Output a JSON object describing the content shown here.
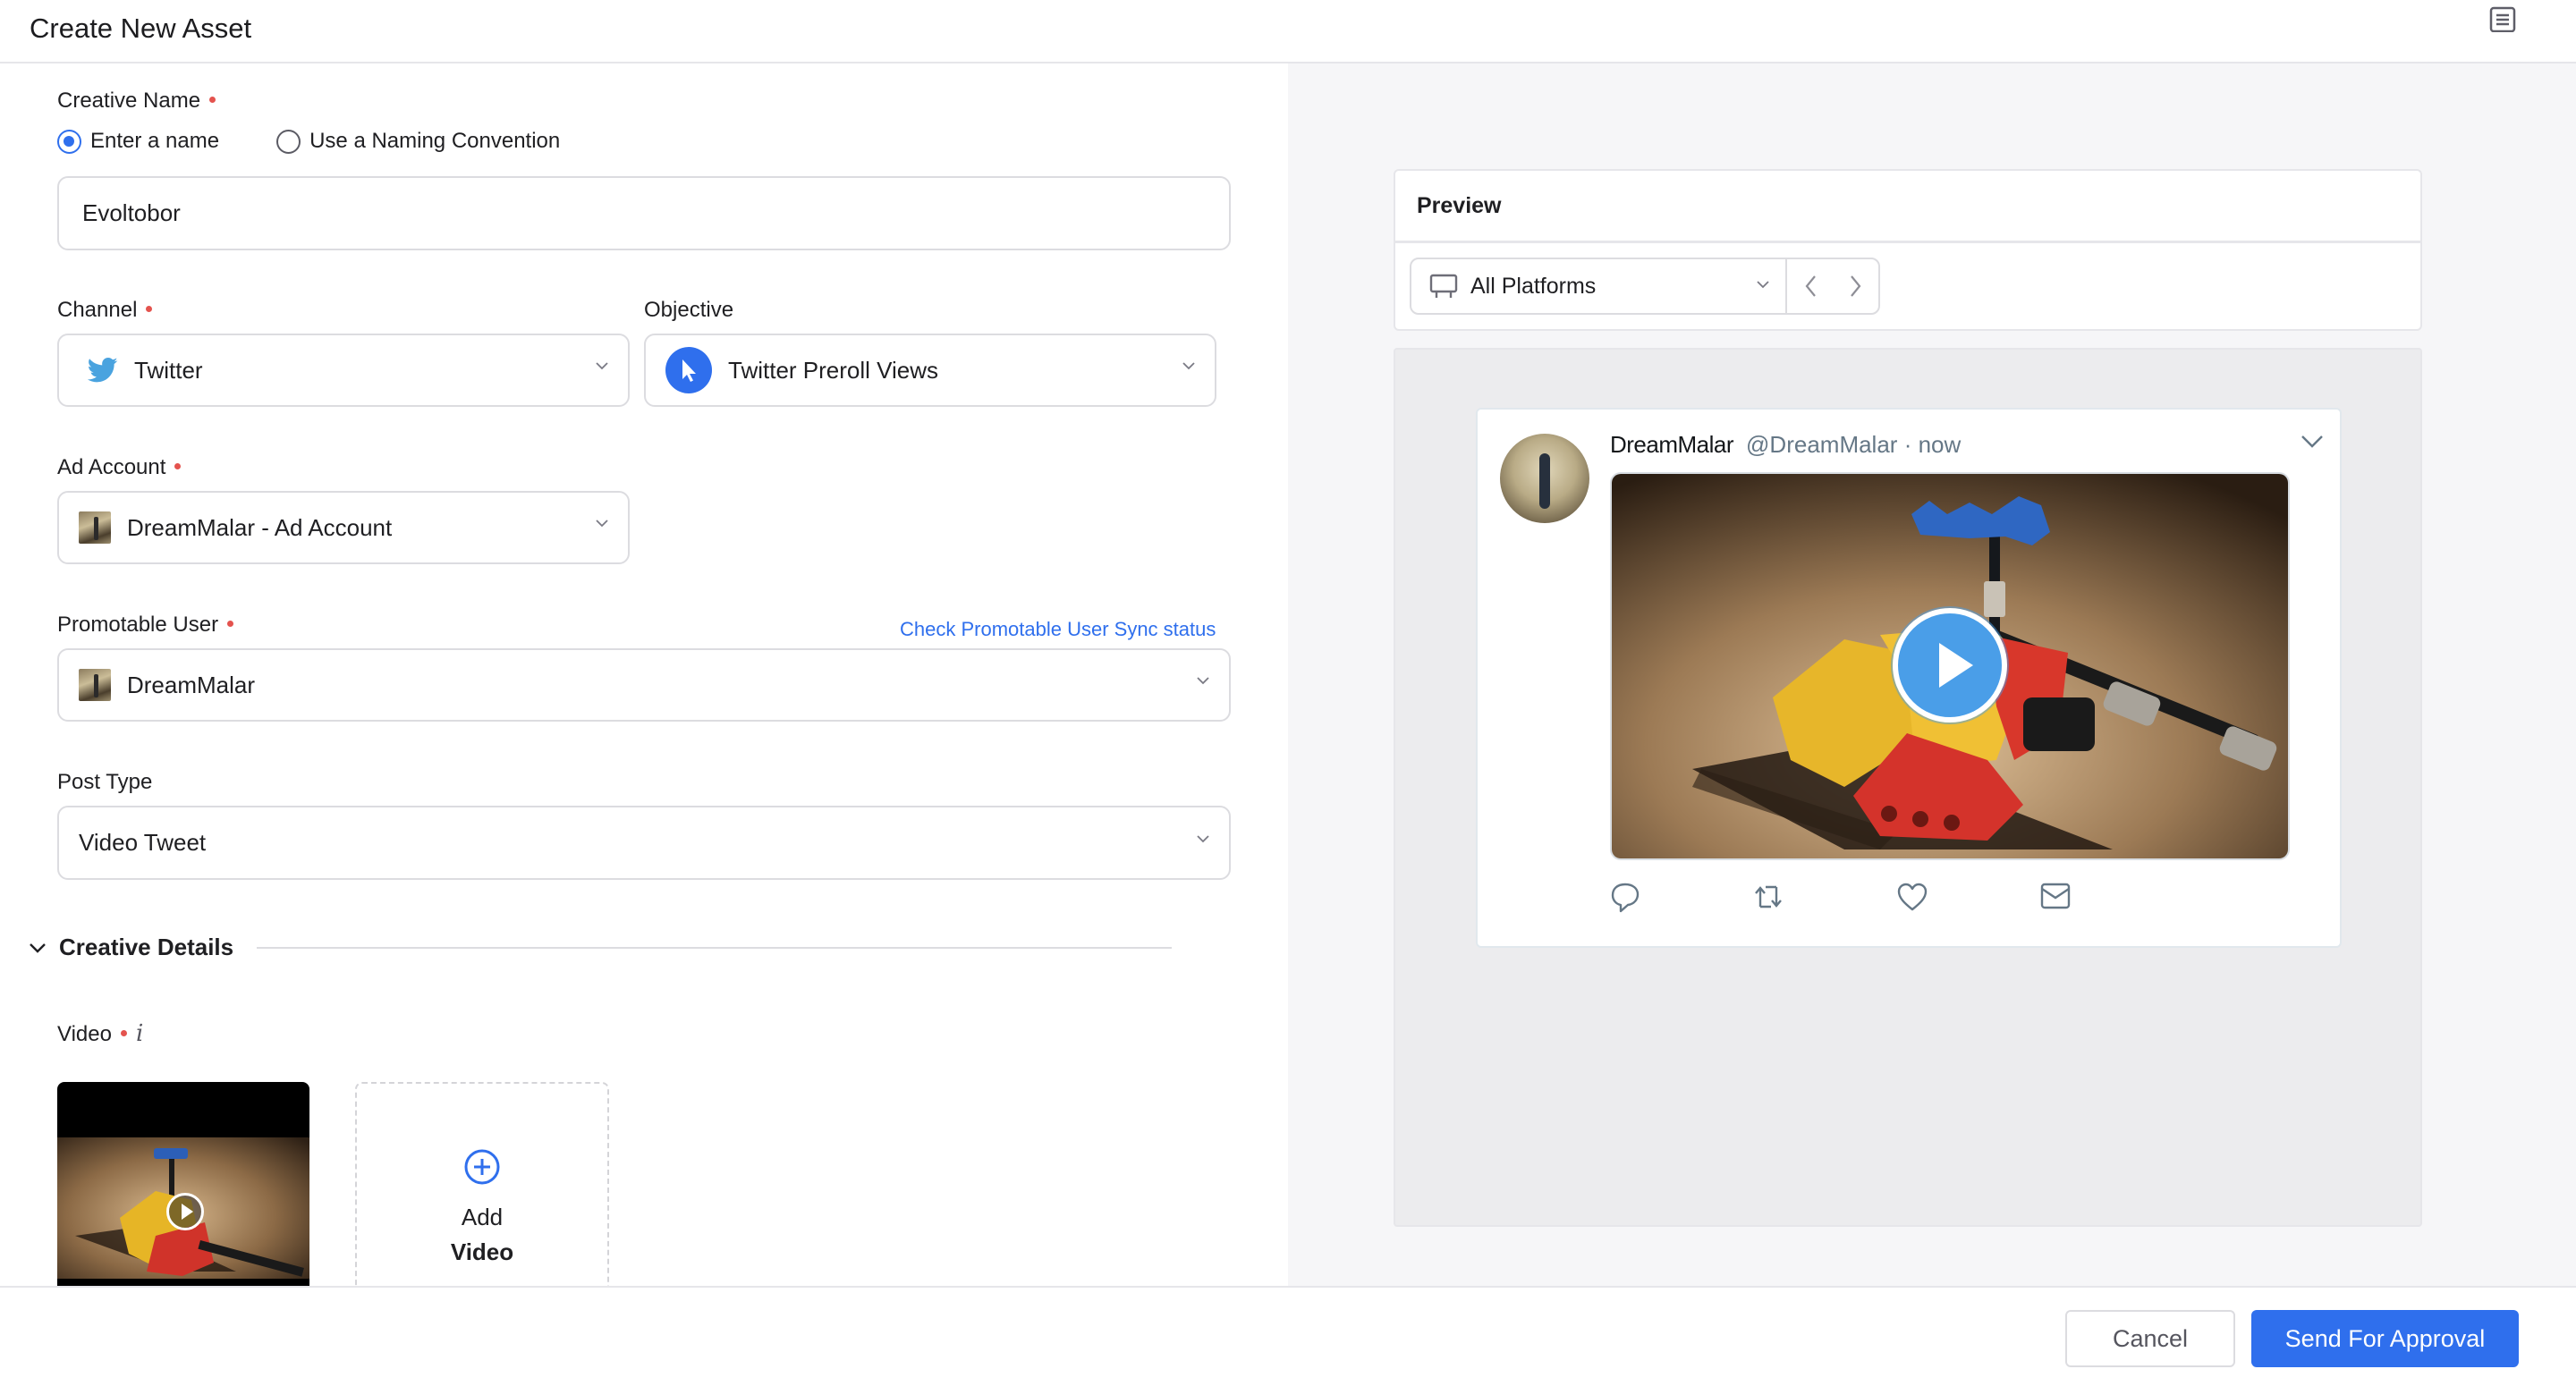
{
  "header": {
    "title": "Create New Asset",
    "right_icon": "document-list-icon"
  },
  "form": {
    "creative_name": {
      "label": "Creative Name",
      "required": true,
      "options": [
        {
          "label": "Enter a name",
          "checked": true
        },
        {
          "label": "Use a Naming Convention",
          "checked": false
        }
      ],
      "value": "Evoltobor"
    },
    "channel": {
      "label": "Channel",
      "required": true,
      "value": "Twitter",
      "icon": "twitter-bird-icon"
    },
    "objective": {
      "label": "Objective",
      "required": false,
      "value": "Twitter Preroll Views",
      "icon": "cursor-icon"
    },
    "ad_account": {
      "label": "Ad Account",
      "required": true,
      "value": "DreamMalar - Ad Account"
    },
    "promotable_user": {
      "label": "Promotable User",
      "required": true,
      "value": "DreamMalar",
      "link": "Check Promotable User Sync status"
    },
    "post_type": {
      "label": "Post Type",
      "required": false,
      "value": "Video Tweet"
    },
    "creative_details": {
      "title": "Creative Details",
      "expanded": true,
      "video": {
        "label": "Video",
        "required": true,
        "info_glyph": "i",
        "add_label_line1": "Add",
        "add_label_line2": "Video"
      }
    }
  },
  "preview": {
    "title": "Preview",
    "platform": "All Platforms",
    "tweet": {
      "display_name": "DreamMalar",
      "handle": "@DreamMalar",
      "separator": "·",
      "time": "now",
      "actions": [
        "reply-icon",
        "retweet-icon",
        "like-icon",
        "direct-message-icon"
      ]
    }
  },
  "footer": {
    "cancel_label": "Cancel",
    "submit_label": "Send For Approval"
  },
  "colors": {
    "accent": "#2f6fed",
    "required_dot": "#e4534e",
    "twitter_blue": "#4a9ee8",
    "tweet_gray": "#657786"
  }
}
